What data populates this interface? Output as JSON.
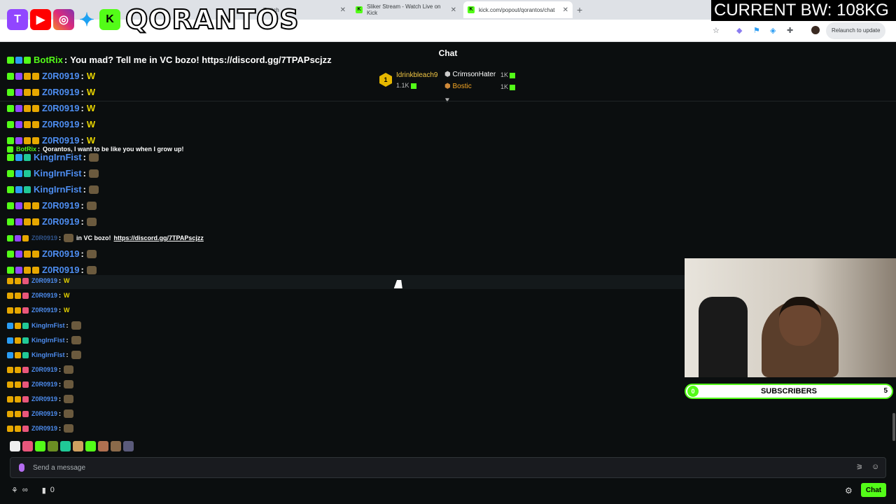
{
  "browser": {
    "tabs": [
      {
        "title": "Twitch"
      },
      {
        "title": "Sliker Stream - Watch Live on Kick"
      },
      {
        "title": "kick.com/popout/qorantos/chat"
      }
    ],
    "relaunch_label": "Relaunch to update"
  },
  "overlay": {
    "brand": "QORANTOS",
    "bandwidth": "CURRENT BW: 108KG"
  },
  "chat": {
    "title": "Chat",
    "gifters": [
      {
        "rank": "1",
        "name": "Idrinkbleach9",
        "count": "1.1K"
      },
      {
        "name": "CrimsonHater",
        "count": "1K"
      },
      {
        "name": "Bostic",
        "count": "1K"
      }
    ],
    "messages": [
      {
        "user": "BotRix",
        "text": "You mad? Tell me in VC bozo! https://discord.gg/7TPAPscjzz"
      },
      {
        "user": "Z0R0919",
        "text": "W"
      },
      {
        "user": "Z0R0919",
        "text": "W"
      },
      {
        "user": "Z0R0919",
        "text": "W"
      },
      {
        "user": "Z0R0919",
        "text": "W"
      },
      {
        "user": "Z0R0919",
        "text": "W"
      },
      {
        "user": "BotRix",
        "text": "Qorantos, I want to be like you when I grow up!"
      },
      {
        "user": "KingIrnFist",
        "text": ""
      },
      {
        "user": "KingIrnFist",
        "text": ""
      },
      {
        "user": "KingIrnFist",
        "text": ""
      },
      {
        "user": "Z0R0919",
        "text": ""
      },
      {
        "user": "Z0R0919",
        "text": ""
      },
      {
        "user": "Z0R0919",
        "text": "in VC bozo!",
        "link": "https://discord.gg/7TPAPscjzz"
      },
      {
        "user": "Z0R0919",
        "text": ""
      },
      {
        "user": "Z0R0919",
        "text": ""
      },
      {
        "user": "Z0R0919",
        "text": "W"
      },
      {
        "user": "Z0R0919",
        "text": "W"
      },
      {
        "user": "Z0R0919",
        "text": "W"
      },
      {
        "user": "KingIrnFist",
        "text": ""
      },
      {
        "user": "KingIrnFist",
        "text": ""
      },
      {
        "user": "KingIrnFist",
        "text": ""
      },
      {
        "user": "Z0R0919",
        "text": ""
      },
      {
        "user": "Z0R0919",
        "text": ""
      },
      {
        "user": "Z0R0919",
        "text": ""
      },
      {
        "user": "Z0R0919",
        "text": ""
      },
      {
        "user": "Z0R0919",
        "text": ""
      }
    ],
    "input_placeholder": "Send a message",
    "viewer_count": "0",
    "chat_button": "Chat"
  },
  "subscriber_goal": {
    "current": "0",
    "label": "SUBSCRIBERS",
    "goal": "5"
  }
}
